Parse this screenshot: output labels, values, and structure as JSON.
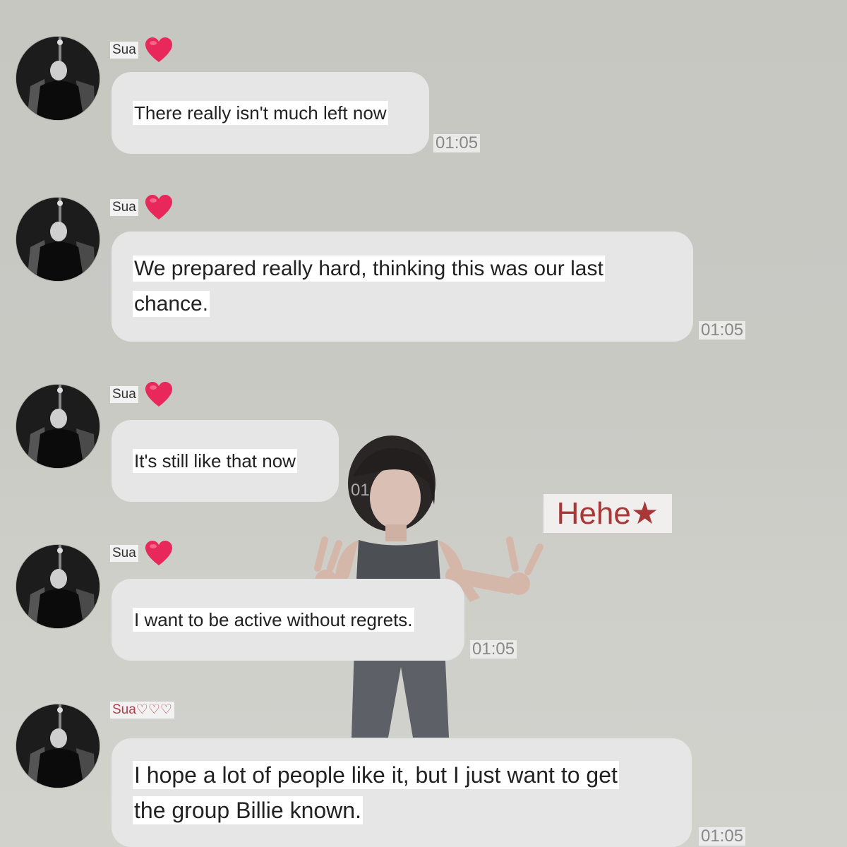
{
  "messages": [
    {
      "sender": "Sua",
      "text": "There really isn't much left now",
      "time": "01:05"
    },
    {
      "sender": "Sua",
      "text_lines": [
        "We prepared really hard, thinking this was our last",
        "chance."
      ],
      "time": "01:05"
    },
    {
      "sender": "Sua",
      "text": "It's still like that now",
      "time": "01"
    },
    {
      "sender": "Sua",
      "text": "I want to be active without regrets.",
      "time": "01:05"
    },
    {
      "sender": "Sua♡♡♡",
      "text_lines": [
        "I hope a lot of people like it, but I just want to get",
        "the group Billie known."
      ],
      "time": "01:05"
    }
  ],
  "sticker": {
    "text": "Hehe★"
  },
  "colors": {
    "heart": "#e8285a",
    "bubble": "#e6e6e6",
    "accent_red": "#a83838"
  },
  "icons": {
    "heart": "heart-icon",
    "avatar": "avatar"
  }
}
